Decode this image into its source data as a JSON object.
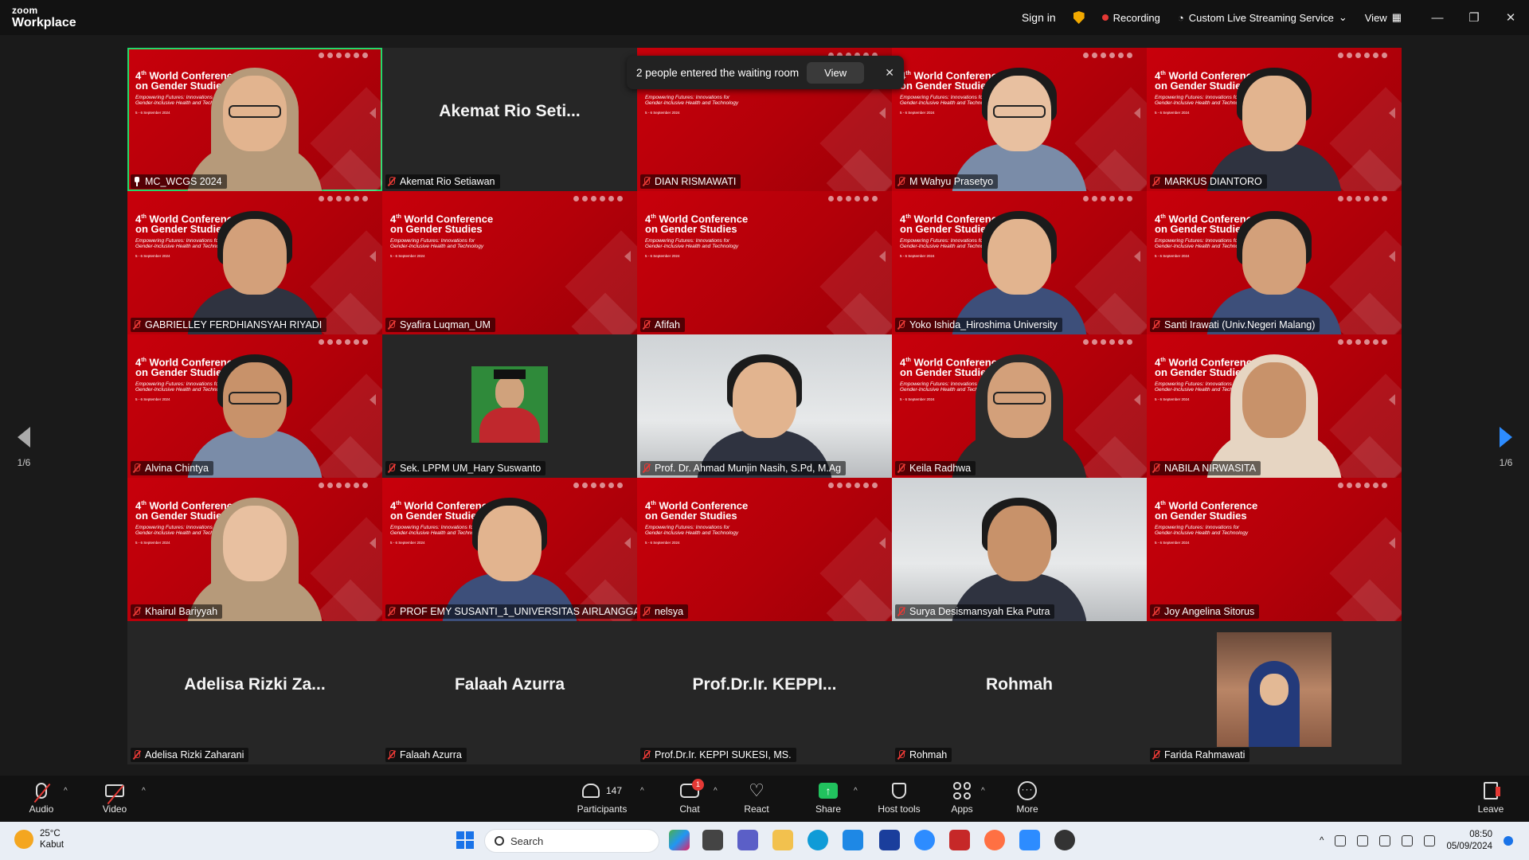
{
  "window": {
    "logo_top": "zoom",
    "logo_bottom": "Workplace",
    "sign_in": "Sign in",
    "recording": "Recording",
    "streaming": "Custom Live Streaming Service",
    "view": "View"
  },
  "toast": {
    "message": "2 people entered the waiting room",
    "view_button": "View",
    "close": "✕"
  },
  "slide": {
    "sup": "th",
    "num": "4",
    "title_line1": " World Conference",
    "title_line2": "on Gender Studies",
    "subtitle": "Empowering Futures: Innovations for Gender-Inclusive Health and Technology",
    "dates": "5 - 6 September 2024"
  },
  "pagination": {
    "left": "1/6",
    "right": "1/6"
  },
  "tiles": [
    {
      "name": "MC_WCGS 2024",
      "kind": "red",
      "person": "hijab"
    },
    {
      "name": "Akemat Rio Setiawan",
      "kind": "name",
      "display": "Akemat Rio Seti..."
    },
    {
      "name": "DIAN RISMAWATI",
      "kind": "red",
      "person": "none"
    },
    {
      "name": "M Wahyu Prasetyo",
      "kind": "red",
      "person": "avatar"
    },
    {
      "name": "MARKUS DIANTORO",
      "kind": "red",
      "person": "man"
    },
    {
      "name": "GABRIELLEY FERDHIANSYAH RIYADI",
      "kind": "red",
      "person": "man"
    },
    {
      "name": "Syafira Luqman_UM",
      "kind": "red",
      "person": "none"
    },
    {
      "name": "Afifah",
      "kind": "red",
      "person": "none"
    },
    {
      "name": "Yoko Ishida_Hiroshima University",
      "kind": "red",
      "person": "woman"
    },
    {
      "name": "Santi Irawati (Univ.Negeri Malang)",
      "kind": "red",
      "person": "woman"
    },
    {
      "name": "Alvina Chintya",
      "kind": "red",
      "person": "avatar"
    },
    {
      "name": "Sek. LPPM UM_Hary Suswanto",
      "kind": "photo",
      "person": "graduate"
    },
    {
      "name": "Prof. Dr. Ahmad Munjin Nasih, S.Pd, M.Ag",
      "kind": "video",
      "person": "man"
    },
    {
      "name": "Keila Radhwa",
      "kind": "red",
      "person": "hijab"
    },
    {
      "name": "NABILA NIRWASITA",
      "kind": "red",
      "person": "hijab"
    },
    {
      "name": "Khairul Bariyyah",
      "kind": "red",
      "person": "hijab"
    },
    {
      "name": "PROF EMY SUSANTI_1_UNIVERSITAS AIRLANGGA",
      "kind": "red",
      "person": "woman"
    },
    {
      "name": "nelsya",
      "kind": "red",
      "person": "none"
    },
    {
      "name": "Surya Desismansyah Eka Putra",
      "kind": "video",
      "person": "man"
    },
    {
      "name": "Joy Angelina Sitorus",
      "kind": "red",
      "person": "none"
    },
    {
      "name": "Adelisa Rizki Zaharani",
      "kind": "name",
      "display": "Adelisa Rizki Za..."
    },
    {
      "name": "Falaah Azurra",
      "kind": "name",
      "display": "Falaah Azurra"
    },
    {
      "name": "Prof.Dr.Ir. KEPPI SUKESI, MS.",
      "kind": "name",
      "display": "Prof.Dr.Ir. KEPPI..."
    },
    {
      "name": "Rohmah",
      "kind": "name",
      "display": "Rohmah"
    },
    {
      "name": "Farida Rahmawati",
      "kind": "photo",
      "person": "hijab"
    }
  ],
  "toolbar": {
    "audio": "Audio",
    "video": "Video",
    "participants": "Participants",
    "participants_count": "147",
    "chat": "Chat",
    "chat_badge": "1",
    "react": "React",
    "share": "Share",
    "host_tools": "Host tools",
    "apps": "Apps",
    "more": "More",
    "leave": "Leave"
  },
  "taskbar": {
    "temp": "25°C",
    "weather": "Kabut",
    "search": "Search",
    "time": "08:50",
    "date": "05/09/2024"
  },
  "colors": {
    "slide_red": "#c8000b",
    "active_speaker": "#23d96b",
    "share_green": "#21c25e",
    "muted_red": "#e53935"
  }
}
